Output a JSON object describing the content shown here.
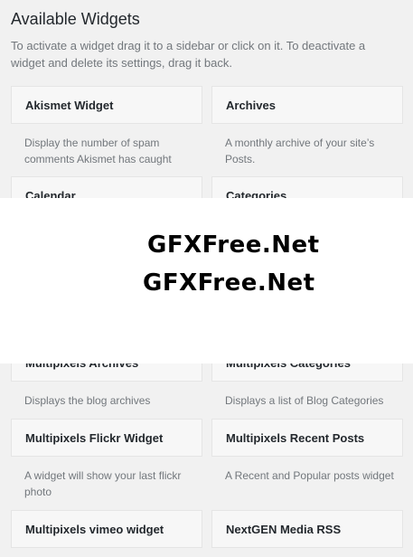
{
  "panel": {
    "title": "Available Widgets",
    "description": "To activate a widget drag it to a sidebar or click on it. To deactivate a widget and delete its settings, drag it back."
  },
  "widgets": [
    {
      "title": "Akismet Widget",
      "description": "Display the number of spam comments Akismet has caught"
    },
    {
      "title": "Archives",
      "description": "A monthly archive of your site’s Posts."
    },
    {
      "title": "Calendar",
      "description": ""
    },
    {
      "title": "Categories",
      "description": ""
    },
    {
      "title": "Multipixels Archives",
      "description": "Displays the blog archives"
    },
    {
      "title": "Multipixels Categories",
      "description": "Displays a list of Blog Categories"
    },
    {
      "title": "Multipixels Flickr Widget",
      "description": "A widget will show your last flickr photo"
    },
    {
      "title": "Multipixels Recent Posts",
      "description": "A Recent and Popular posts widget"
    },
    {
      "title": "Multipixels vimeo widget",
      "description": ""
    },
    {
      "title": "NextGEN Media RSS",
      "description": ""
    }
  ],
  "watermark": {
    "line1": "GFXFree.Net",
    "line2": "GFXFree.Net"
  }
}
